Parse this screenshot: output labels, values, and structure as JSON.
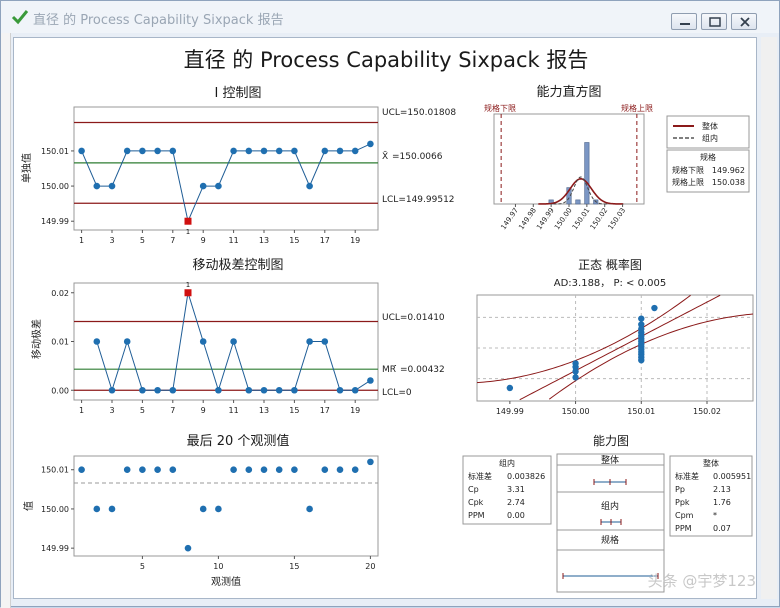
{
  "window": {
    "title": "直径 的 Process Capability Sixpack 报告",
    "report_title": "直径 的 Process Capability Sixpack 报告"
  },
  "i_chart": {
    "title": "I 控制图",
    "ylabel": "单独值",
    "ucl_label": "UCL=150.01808",
    "center_label": "=150.0066",
    "center_symbol": "X̄",
    "lcl_label": "LCL=149.99512",
    "yticks": [
      "150.01",
      "150.00",
      "149.99"
    ],
    "xticks": [
      "1",
      "3",
      "5",
      "7",
      "9",
      "11",
      "13",
      "15",
      "17",
      "19"
    ],
    "ooc_flag": "1",
    "colors": {
      "limit": "#8b1a1a",
      "center": "#2e7d32",
      "line": "#1f5d96",
      "point": "#1f6fb0",
      "ooc": "#d01010"
    }
  },
  "mr_chart": {
    "title": "移动极差控制图",
    "ylabel": "移动极差",
    "ucl_label": "UCL=0.01410",
    "center_symbol": "MR",
    "center_label": "=0.00432",
    "lcl_label": "LCL=0",
    "yticks": [
      "0.02",
      "0.01",
      "0.00"
    ],
    "xticks": [
      "1",
      "3",
      "5",
      "7",
      "9",
      "11",
      "13",
      "15",
      "17",
      "19"
    ],
    "ooc_flag": "1"
  },
  "last20": {
    "title": "最后 20 个观测值",
    "ylabel": "值",
    "xlabel": "观测值",
    "yticks": [
      "150.01",
      "150.00",
      "149.99"
    ],
    "xticks": [
      "5",
      "10",
      "15",
      "20"
    ]
  },
  "histogram": {
    "title": "能力直方图",
    "lsl_label": "规格下限",
    "usl_label": "规格上限",
    "xticks": [
      "149.97",
      "149.98",
      "149.99",
      "150.00",
      "150.01",
      "150.02",
      "150.03"
    ],
    "legend": {
      "overall": "整体",
      "within": "组内",
      "spec_title": "规格",
      "lsl_name": "规格下限",
      "lsl_value": "149.962",
      "usl_name": "规格上限",
      "usl_value": "150.038"
    }
  },
  "normal_plot": {
    "title": "正态 概率图",
    "subtitle": "AD:3.188， P: < 0.005",
    "xticks": [
      "149.99",
      "150.00",
      "150.01",
      "150.02"
    ]
  },
  "capability": {
    "title": "能力图",
    "within": {
      "title": "组内",
      "rows": [
        {
          "name": "标准差",
          "value": "0.003826"
        },
        {
          "name": "Cp",
          "value": "3.31"
        },
        {
          "name": "Cpk",
          "value": "2.74"
        },
        {
          "name": "PPM",
          "value": "0.00"
        }
      ]
    },
    "overall": {
      "title": "整体",
      "rows": [
        {
          "name": "标准差",
          "value": "0.005951"
        },
        {
          "name": "Pp",
          "value": "2.13"
        },
        {
          "name": "Ppk",
          "value": "1.76"
        },
        {
          "name": "Cpm",
          "value": "*"
        },
        {
          "name": "PPM",
          "value": "0.07"
        }
      ]
    },
    "bar_labels": {
      "overall": "整体",
      "within": "组内",
      "spec": "规格"
    }
  },
  "watermark": "头条 @宇梦123",
  "chart_data": [
    {
      "type": "line",
      "title": "I 控制图",
      "ylabel": "单独值",
      "x": [
        1,
        2,
        3,
        4,
        5,
        6,
        7,
        8,
        9,
        10,
        11,
        12,
        13,
        14,
        15,
        16,
        17,
        18,
        19,
        20
      ],
      "series": [
        {
          "values": [
            150.01,
            150.0,
            150.0,
            150.01,
            150.01,
            150.01,
            150.01,
            149.99,
            150.0,
            150.0,
            150.01,
            150.01,
            150.01,
            150.01,
            150.01,
            150.0,
            150.01,
            150.01,
            150.01,
            150.012
          ]
        }
      ],
      "ucl": 150.01808,
      "center": 150.0066,
      "lcl": 149.99512,
      "ylim": [
        149.9875,
        150.0225
      ],
      "xlim": [
        0.5,
        20.5
      ]
    },
    {
      "type": "line",
      "title": "移动极差控制图",
      "ylabel": "移动极差",
      "x": [
        2,
        3,
        4,
        5,
        6,
        7,
        8,
        9,
        10,
        11,
        12,
        13,
        14,
        15,
        16,
        17,
        18,
        19,
        20
      ],
      "series": [
        {
          "values": [
            0.01,
            0.0,
            0.01,
            0.0,
            0.0,
            0.0,
            0.02,
            0.01,
            0.0,
            0.01,
            0.0,
            0.0,
            0.0,
            0.0,
            0.01,
            0.01,
            0.0,
            0.0,
            0.002
          ]
        }
      ],
      "ucl": 0.0141,
      "center": 0.00432,
      "lcl": 0,
      "ylim": [
        -0.002,
        0.022
      ],
      "xlim": [
        0.5,
        20.5
      ]
    },
    {
      "type": "scatter",
      "title": "最后 20 个观测值",
      "xlabel": "观测值",
      "ylabel": "值",
      "x": [
        1,
        2,
        3,
        4,
        5,
        6,
        7,
        8,
        9,
        10,
        11,
        12,
        13,
        14,
        15,
        16,
        17,
        18,
        19,
        20
      ],
      "series": [
        {
          "values": [
            150.01,
            150.0,
            150.0,
            150.01,
            150.01,
            150.01,
            150.01,
            149.99,
            150.0,
            150.0,
            150.01,
            150.01,
            150.01,
            150.01,
            150.01,
            150.0,
            150.01,
            150.01,
            150.01,
            150.012
          ]
        }
      ],
      "mean": 150.0066,
      "ylim": [
        149.988,
        150.0135
      ],
      "xlim": [
        0.5,
        20.5
      ]
    },
    {
      "type": "bar",
      "title": "能力直方图",
      "bins": [
        {
          "x": 149.99,
          "height": 0.05
        },
        {
          "x": 150.0,
          "height": 0.2
        },
        {
          "x": 150.005,
          "height": 0.05
        },
        {
          "x": 150.01,
          "height": 0.75
        },
        {
          "x": 150.015,
          "height": 0.05
        }
      ],
      "lsl": 149.962,
      "usl": 150.038,
      "xlim": [
        149.958,
        150.042
      ],
      "curves": [
        {
          "name": "整体",
          "mean": 150.0066,
          "sd": 0.005951
        },
        {
          "name": "组内",
          "mean": 150.0066,
          "sd": 0.003826
        }
      ]
    },
    {
      "type": "scatter",
      "title": "正态 概率图",
      "x": [
        149.99,
        150.0,
        150.0,
        150.0,
        150.0,
        150.01,
        150.01,
        150.01,
        150.01,
        150.01,
        150.01,
        150.01,
        150.01,
        150.01,
        150.01,
        150.01,
        150.01,
        150.01,
        150.01,
        150.012
      ],
      "y_percent": [
        2.5,
        7.5,
        12.5,
        17.5,
        22.5,
        27.5,
        32.5,
        37.5,
        42.5,
        47.5,
        52.5,
        57.5,
        62.5,
        67.5,
        72.5,
        77.5,
        82.5,
        87.5,
        92.5,
        97.5
      ],
      "xlim": [
        149.985,
        150.027
      ],
      "mean": 150.0066,
      "sd": 0.005951
    }
  ]
}
